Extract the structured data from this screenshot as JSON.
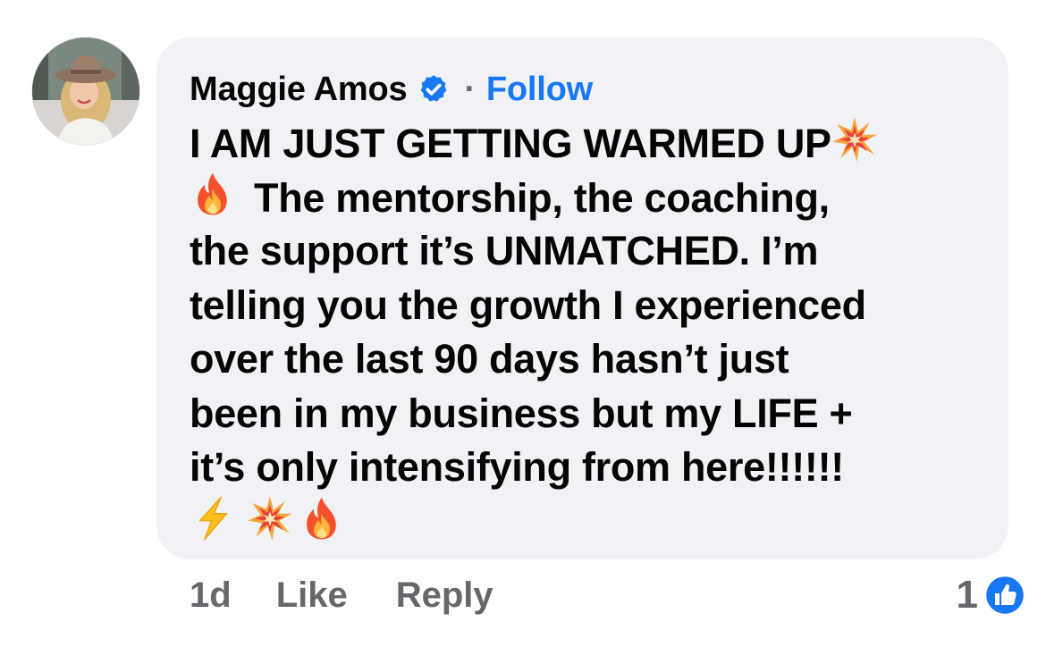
{
  "comment": {
    "author": {
      "name": "Maggie Amos",
      "verified": true,
      "avatar_icon": "profile-photo-woman-hat"
    },
    "separator": "·",
    "follow_label": "Follow",
    "lines": [
      "I AM JUST GETTING WARMED UP",
      "The mentorship, the coaching,",
      "the support it’s UNMATCHED. I’m",
      "telling you the growth I experienced",
      "over the last 90 days hasn’t just",
      "been in my business but my LIFE +",
      "it’s only intensifying from here!!!!!!"
    ],
    "emojis": {
      "after_line_1": "collision-emoji",
      "before_line_2": "fire-emoji",
      "final_row": [
        "high-voltage-emoji",
        "collision-emoji",
        "fire-emoji"
      ]
    }
  },
  "actions": {
    "time": "1d",
    "like_label": "Like",
    "reply_label": "Reply"
  },
  "reactions": {
    "count": "1",
    "icon": "like-thumb-icon",
    "color": "#1877f2"
  },
  "colors": {
    "bubble_bg": "#f0f2f5",
    "text": "#050505",
    "muted": "#65676b",
    "link": "#1877f2"
  }
}
